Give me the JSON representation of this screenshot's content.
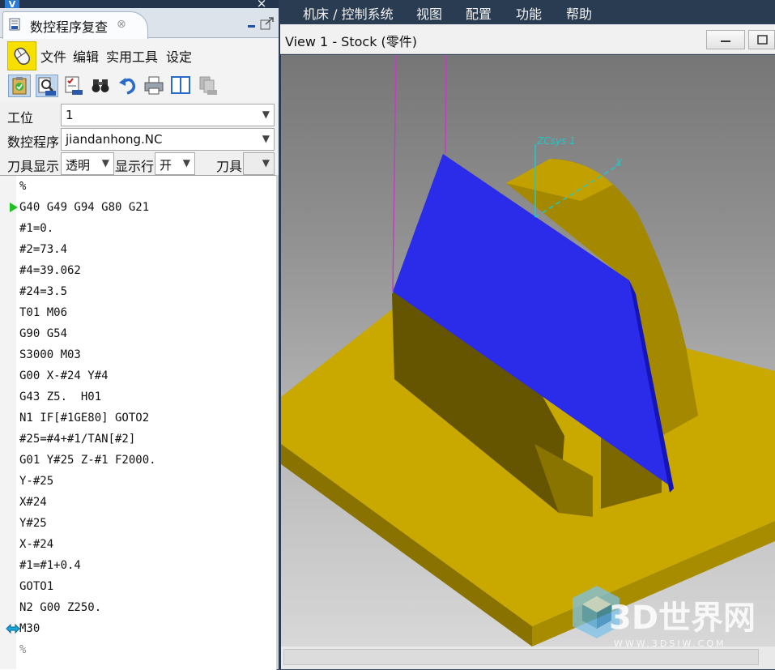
{
  "app": {
    "logo_letter": "V",
    "close_glyph": "×"
  },
  "panel": {
    "tab_title": "数控程序复查",
    "tab_close": "⊗",
    "tab_icon": "nc-document-icon"
  },
  "menu": {
    "items": [
      "文件",
      "编辑",
      "实用工具",
      "设定"
    ]
  },
  "toolbar": {
    "icons": [
      "check-clipboard-icon",
      "zoom-nc-icon",
      "checklist-nc-icon",
      "binoculars-icon",
      "undo-icon",
      "print-icon",
      "split-view-icon",
      "disabled-nc-icon"
    ]
  },
  "form": {
    "station_label": "工位",
    "station_value": "1",
    "program_label": "数控程序",
    "program_value": "jiandanhong.NC",
    "tool_display_label": "刀具显示",
    "tool_display_value": "透明",
    "show_line_label": "显示行",
    "show_line_value": "开",
    "tool_label": "刀具",
    "tool_value": ""
  },
  "code": {
    "lines": [
      "%",
      "G40 G49 G94 G80 G21",
      "#1=0.",
      "#2=73.4",
      "#4=39.062",
      "#24=3.5",
      "T01 M06",
      "G90 G54",
      "S3000 M03",
      "G00 X-#24 Y#4",
      "G43 Z5.  H01",
      "N1 IF[#1GE80] GOTO2",
      "#25=#4+#1/TAN[#2]",
      "G01 Y#25 Z-#1 F2000.",
      "Y-#25",
      "X#24",
      "Y#25",
      "X-#24",
      "#1=#1+0.4",
      "GOTO1",
      "N2 G00 Z250.",
      "M30",
      "%"
    ],
    "current_line_index": 1,
    "marker_line_index": 21
  },
  "main_menu": {
    "items": [
      "机床 / 控制系统",
      "视图",
      "配置",
      "功能",
      "帮助"
    ]
  },
  "viewport": {
    "title": "View 1 - Stock (零件)",
    "csys_label": "ZCsys 1",
    "x_axis_label": "X"
  },
  "watermark": {
    "brand": "3D世界网",
    "url": "WWW.3DSJW.COM"
  },
  "colors": {
    "part_yellow": "#c9a800",
    "part_yellow_dark": "#6e5a00",
    "cut_blue": "#2b2bea",
    "tool_magenta": "#c040c0",
    "axis_cyan": "#20c8c8",
    "current_marker": "#20c020",
    "title_bar": "#2a3c52"
  }
}
